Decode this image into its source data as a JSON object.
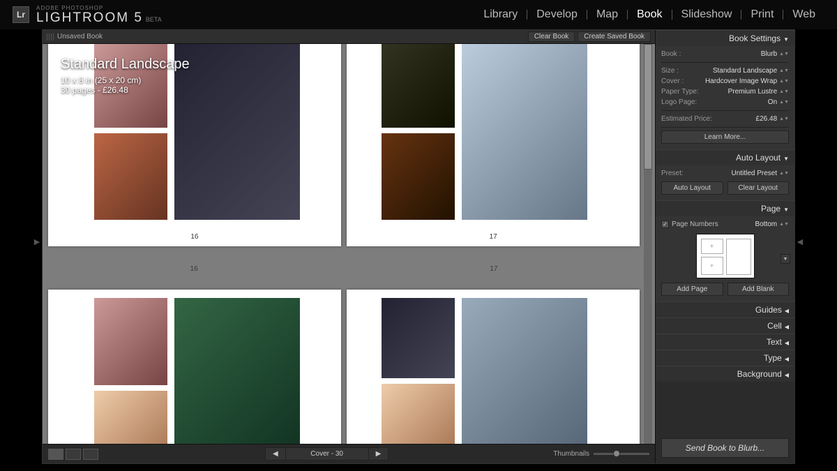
{
  "header": {
    "brand_sup": "ADOBE PHOTOSHOP",
    "brand_main": "LIGHTROOM 5",
    "brand_beta": "BETA",
    "logo_text": "Lr",
    "nav": [
      "Library",
      "Develop",
      "Map",
      "Book",
      "Slideshow",
      "Print",
      "Web"
    ],
    "nav_active": "Book"
  },
  "topbar": {
    "title": "Unsaved Book",
    "clear_btn": "Clear Book",
    "create_btn": "Create Saved Book"
  },
  "overlay": {
    "title": "Standard Landscape",
    "dims": "10 x 8 in (25 x 20 cm)",
    "pages_price": "30 pages - £26.48"
  },
  "page_numbers": {
    "left_in": "16",
    "right_in": "17",
    "left_out": "16",
    "right_out": "17"
  },
  "bottombar": {
    "pager_label": "Cover - 30",
    "thumbnails_label": "Thumbnails"
  },
  "panels": {
    "book_settings": {
      "title": "Book Settings",
      "book_lbl": "Book :",
      "book_val": "Blurb",
      "size_lbl": "Size :",
      "size_val": "Standard Landscape",
      "cover_lbl": "Cover :",
      "cover_val": "Hardcover Image Wrap",
      "paper_lbl": "Paper Type:",
      "paper_val": "Premium Lustre",
      "logo_lbl": "Logo Page:",
      "logo_val": "On",
      "price_lbl": "Estimated Price:",
      "price_val": "£26.48",
      "learn_btn": "Learn More..."
    },
    "auto_layout": {
      "title": "Auto Layout",
      "preset_lbl": "Preset:",
      "preset_val": "Untitled Preset",
      "auto_btn": "Auto Layout",
      "clear_btn": "Clear Layout"
    },
    "page": {
      "title": "Page",
      "numbers_lbl": "Page Numbers",
      "numbers_val": "Bottom",
      "add_page_btn": "Add Page",
      "add_blank_btn": "Add Blank"
    },
    "collapsed": [
      "Guides",
      "Cell",
      "Text",
      "Type",
      "Background"
    ],
    "send_btn": "Send Book to Blurb..."
  }
}
